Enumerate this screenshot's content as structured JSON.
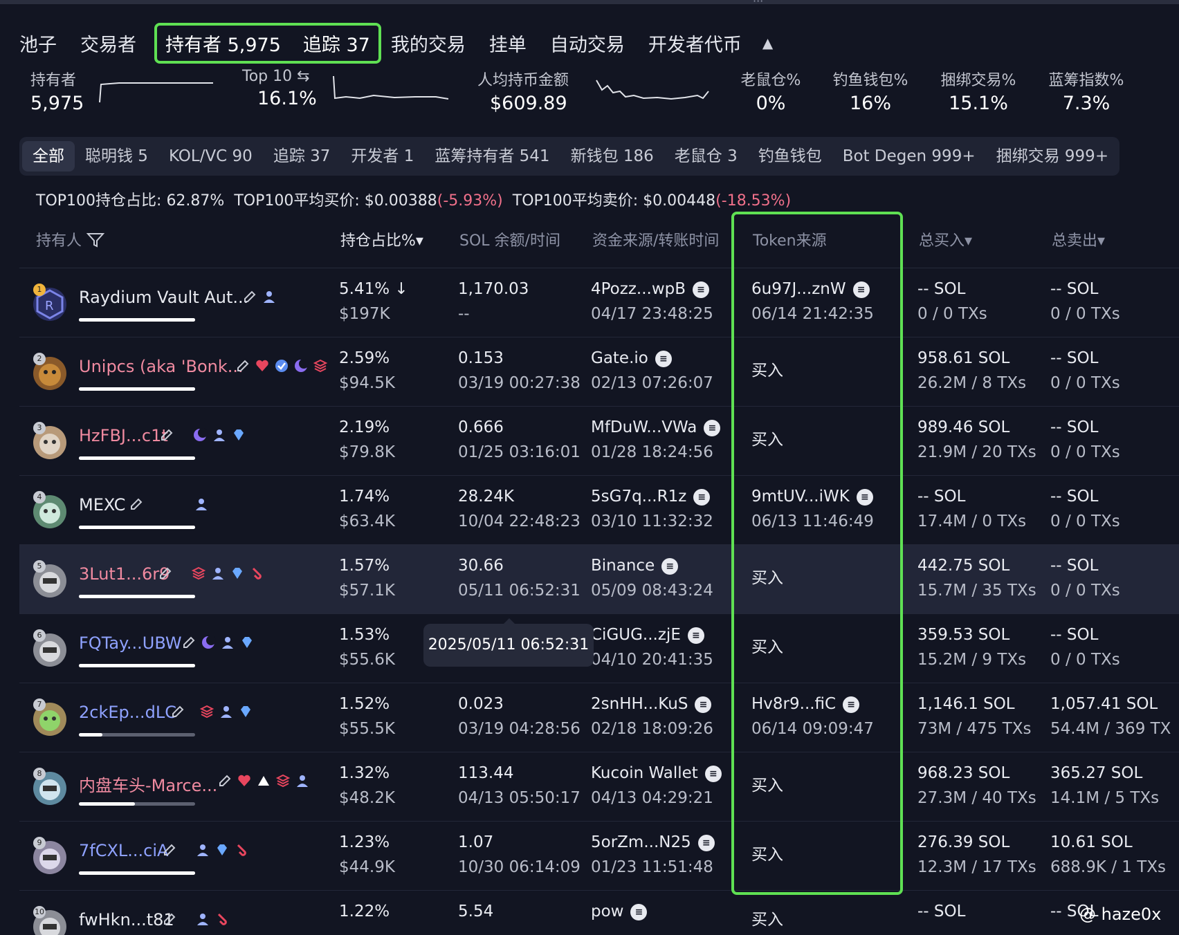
{
  "nav": {
    "tabs": [
      "池子",
      "交易者"
    ],
    "highlighted": [
      "持有者 5,975",
      "追踪 37"
    ],
    "tabs_after": [
      "我的交易",
      "挂单",
      "自动交易",
      "开发者代币"
    ],
    "collapse_glyph": "▲"
  },
  "stats": {
    "holders_label": "持有者",
    "holders_value": "5,975",
    "top10_label": "Top 10 ⇆",
    "top10_value": "16.1%",
    "avg_label": "人均持币金额",
    "avg_value": "$609.89",
    "rat_label": "老鼠仓%",
    "rat_value": "0%",
    "phish_label": "钓鱼钱包%",
    "phish_value": "16%",
    "bundle_label": "捆绑交易%",
    "bundle_value": "15.1%",
    "bluechip_label": "蓝筹指数%",
    "bluechip_value": "7.3%"
  },
  "chips": [
    "全部",
    "聪明钱 5",
    "KOL/VC 90",
    "追踪 37",
    "开发者 1",
    "蓝筹持有者 541",
    "新钱包 186",
    "老鼠仓 3",
    "钓鱼钱包",
    "Bot Degen 999+",
    "捆绑交易 999+"
  ],
  "top100": {
    "share_label": "TOP100持仓占比:",
    "share_value": "62.87%",
    "avg_buy_label": "TOP100平均买价:",
    "avg_buy_value": "$0.00388",
    "avg_buy_change": "(-5.93%)",
    "avg_sell_label": "TOP100平均卖价:",
    "avg_sell_value": "$0.00448",
    "avg_sell_change": "(-18.53%)"
  },
  "columns": {
    "holder": "持有人",
    "pct": "持仓占比%▾",
    "sol": "SOL 余额/时间",
    "funding": "资金来源/转账时间",
    "token": "Token来源",
    "buy": "总买入▾",
    "sell": "总卖出▾"
  },
  "rows": [
    {
      "rank": "1",
      "name": "Raydium Vault Aut...",
      "pct": "5.41% ↓",
      "usd": "$197K",
      "sol": "1,170.03",
      "sol_time": "--",
      "fund": "4Pozz...wpB",
      "fund_time": "04/17 23:48:25",
      "token": "6u97J...znW",
      "token_time": "06/14 21:42:35",
      "buy": "-- SOL",
      "buy_tx": "0 / 0 TXs",
      "sell": "-- SOL",
      "sell_tx": "0 / 0 TXs"
    },
    {
      "rank": "2",
      "name": "Unipcs (aka 'Bonk...",
      "pct": "2.59%",
      "usd": "$94.5K",
      "sol": "0.153",
      "sol_time": "03/19 00:27:38",
      "fund": "Gate.io",
      "fund_time": "02/13 07:26:07",
      "token": "买入",
      "token_time": "",
      "buy": "958.61 SOL",
      "buy_tx": "26.2M / 8 TXs",
      "sell": "-- SOL",
      "sell_tx": "0 / 0 TXs"
    },
    {
      "rank": "3",
      "name": "HzFBJ...c1t",
      "pct": "2.19%",
      "usd": "$79.8K",
      "sol": "0.666",
      "sol_time": "01/25 03:16:01",
      "fund": "MfDuW...VWa",
      "fund_time": "01/28 18:24:56",
      "token": "买入",
      "token_time": "",
      "buy": "989.46 SOL",
      "buy_tx": "21.9M / 20 TXs",
      "sell": "-- SOL",
      "sell_tx": "0 / 0 TXs"
    },
    {
      "rank": "4",
      "name": "MEXC",
      "pct": "1.74%",
      "usd": "$63.4K",
      "sol": "28.24K",
      "sol_time": "10/04 22:48:23",
      "fund": "5sG7q...R1z",
      "fund_time": "03/10 11:32:32",
      "token": "9mtUV...iWK",
      "token_time": "06/13 11:46:49",
      "buy": "-- SOL",
      "buy_tx": "17.4M / 0 TXs",
      "sell": "-- SOL",
      "sell_tx": "0 / 0 TXs"
    },
    {
      "rank": "5",
      "name": "3Lut1...6r9",
      "pct": "1.57%",
      "usd": "$57.1K",
      "sol": "30.66",
      "sol_time": "05/11 06:52:31",
      "fund": "Binance",
      "fund_time": "05/09 08:43:24",
      "token": "买入",
      "token_time": "",
      "buy": "442.75 SOL",
      "buy_tx": "15.7M / 35 TXs",
      "sell": "-- SOL",
      "sell_tx": "0 / 0 TXs"
    },
    {
      "rank": "6",
      "name": "FQTay...UBW",
      "pct": "1.53%",
      "usd": "$55.6K",
      "sol": "",
      "sol_time": "",
      "fund": "CiGUG...zjE",
      "fund_time": "04/10 20:41:35",
      "token": "买入",
      "token_time": "",
      "buy": "359.53 SOL",
      "buy_tx": "15.2M / 9 TXs",
      "sell": "-- SOL",
      "sell_tx": "0 / 0 TXs"
    },
    {
      "rank": "7",
      "name": "2ckEp...dLC",
      "pct": "1.52%",
      "usd": "$55.5K",
      "sol": "0.023",
      "sol_time": "03/19 04:28:56",
      "fund": "2snHH...KuS",
      "fund_time": "02/18 18:09:26",
      "token": "Hv8r9...fiC",
      "token_time": "06/14 09:09:47",
      "buy": "1,146.1 SOL",
      "buy_tx": "73M / 475 TXs",
      "sell": "1,057.41 SOL",
      "sell_tx": "54.4M / 369 TX"
    },
    {
      "rank": "8",
      "name": "内盘车头-Marce...",
      "pct": "1.32%",
      "usd": "$48.2K",
      "sol": "113.44",
      "sol_time": "04/13 05:50:17",
      "fund": "Kucoin Wallet",
      "fund_time": "04/13 04:29:21",
      "token": "买入",
      "token_time": "",
      "buy": "968.23 SOL",
      "buy_tx": "27.3M / 40 TXs",
      "sell": "365.27 SOL",
      "sell_tx": "14.1M / 5 TXs"
    },
    {
      "rank": "9",
      "name": "7fCXL...ciA",
      "pct": "1.23%",
      "usd": "$44.9K",
      "sol": "1.07",
      "sol_time": "10/30 06:14:09",
      "fund": "5orZm...N25",
      "fund_time": "01/23 11:51:48",
      "token": "买入",
      "token_time": "",
      "buy": "276.39 SOL",
      "buy_tx": "12.3M / 17 TXs",
      "sell": "10.61 SOL",
      "sell_tx": "688.9K / 1 TXs"
    },
    {
      "rank": "10",
      "name": "fwHkn...t81",
      "pct": "1.22%",
      "usd": "",
      "sol": "5.54",
      "sol_time": "",
      "fund": "pow",
      "fund_time": "",
      "token": "买入",
      "token_time": "",
      "buy": "-- SOL",
      "buy_tx": "",
      "sell": "-- SOL",
      "sell_tx": ""
    }
  ],
  "tooltip": "2025/05/11 06:52:31",
  "watermark": "@ haze0x",
  "colors": {
    "accent_green": "#5fe053",
    "negative": "#f0708a",
    "bg": "#121522",
    "name_pink": "#f08aa0",
    "name_blue": "#8fa2ff"
  }
}
